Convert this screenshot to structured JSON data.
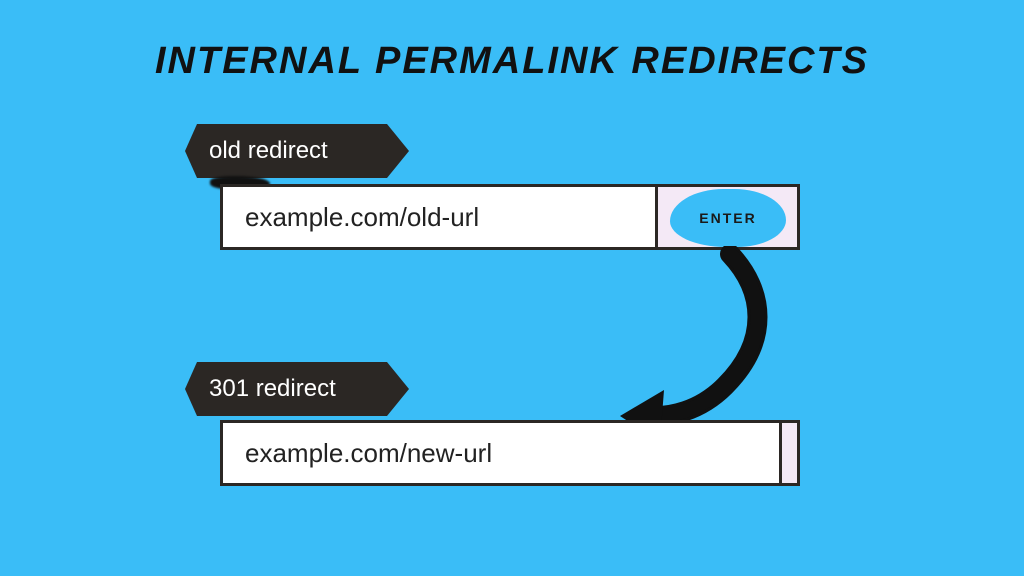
{
  "title": "INTERNAL PERMALINK REDIRECTS",
  "tag_old": "old redirect",
  "tag_new": "301 redirect",
  "url_old": "example.com/old-url",
  "url_new": "example.com/new-url",
  "enter_label": "ENTER",
  "colors": {
    "background": "#3ABDF7",
    "tag_bg": "#2b2724",
    "side_bg": "#F4E9F6"
  }
}
